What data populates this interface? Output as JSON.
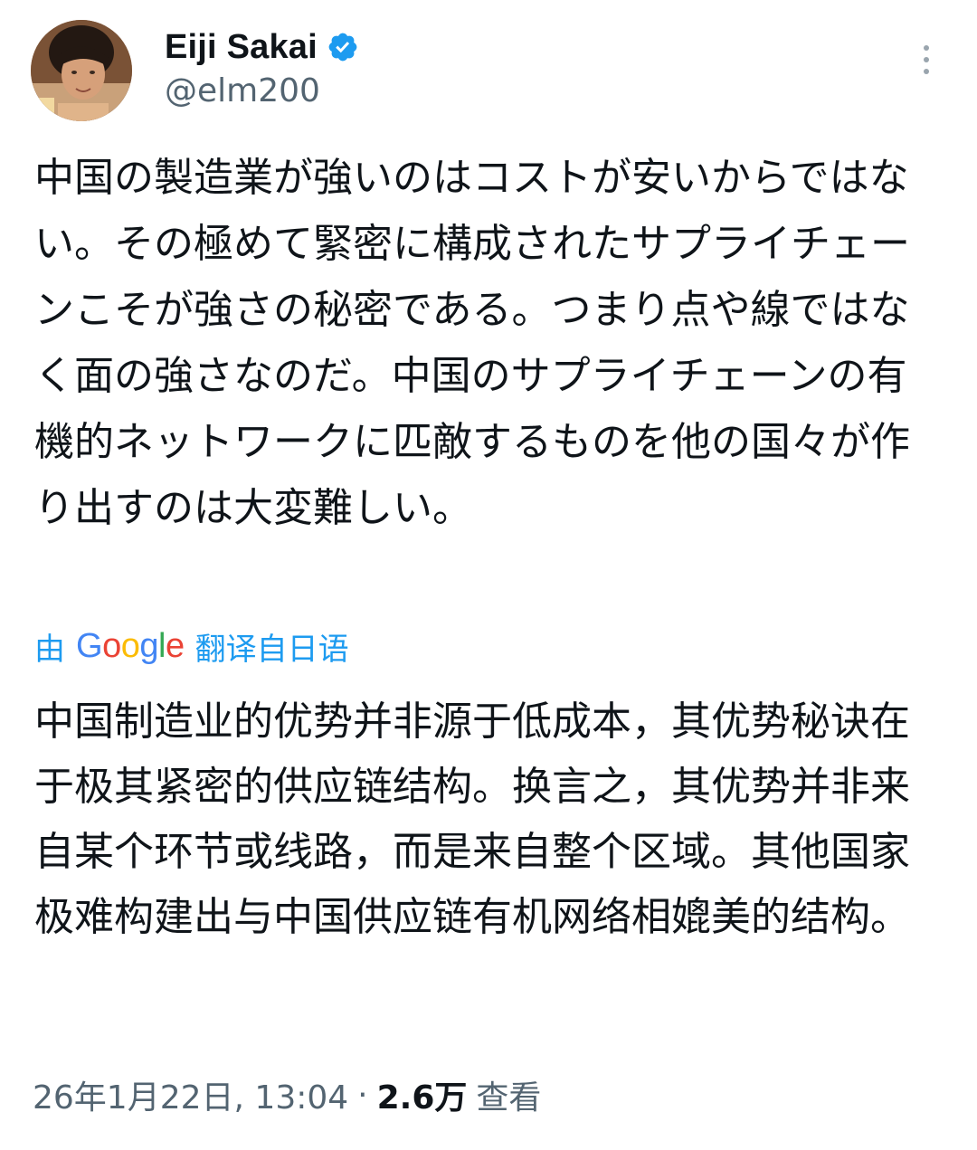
{
  "author": {
    "display_name": "Eiji Sakai",
    "handle": "@elm200",
    "verified": true,
    "verified_color": "#1d9bf0"
  },
  "tweet": {
    "text": "中国の製造業が強いのはコストが安いからではない。その極めて緊密に構成されたサプライチェーンこそが強さの秘密である。つまり点や線ではなく面の強さなのだ。中国のサプライチェーンの有機的ネットワークに匹敵するものを他の国々が作り出すのは大変難しい。"
  },
  "translation": {
    "prefix": "由",
    "provider": "Google",
    "suffix": "翻译自日语",
    "link_color": "#1d9bf0",
    "text": "中国制造业的优势并非源于低成本，其优势秘诀在于极其紧密的供应链结构。换言之，其优势并非来自某个环节或线路，而是来自整个区域。其他国家极难构建出与中国供应链有机网络相媲美的结构。"
  },
  "meta": {
    "timestamp": "26年1月22日, 13:04",
    "separator": "·",
    "views_count": "2.6万",
    "views_label": "查看"
  },
  "icons": {
    "verified": "verified-badge-icon",
    "more": "more-vertical-icon",
    "avatar": "avatar-photo"
  }
}
